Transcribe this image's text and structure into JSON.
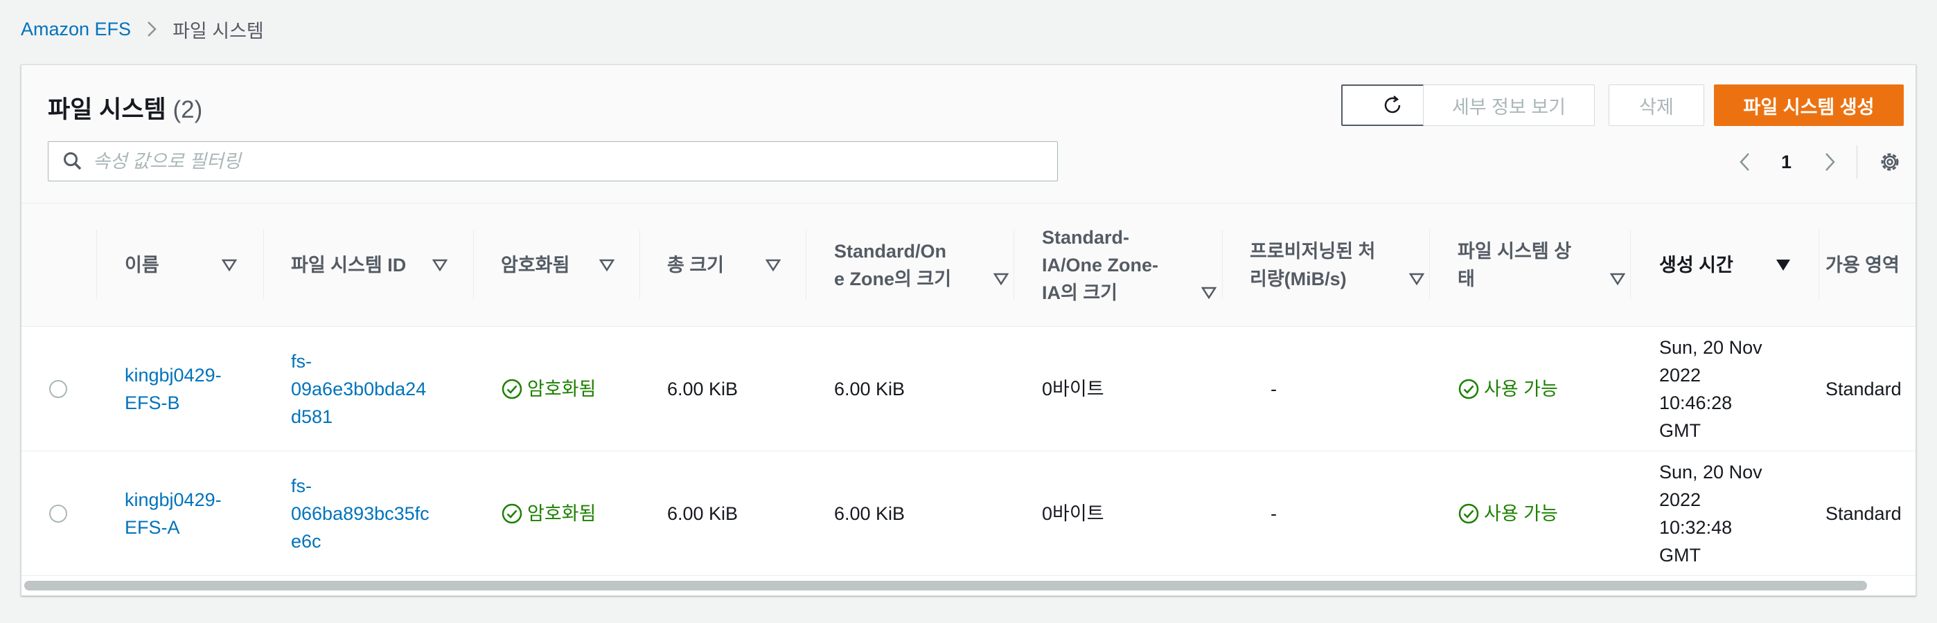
{
  "breadcrumb": {
    "root": "Amazon EFS",
    "current": "파일 시스템"
  },
  "panel": {
    "title": "파일 시스템",
    "count": "(2)",
    "buttons": {
      "details": "세부 정보 보기",
      "delete": "삭제",
      "create": "파일 시스템 생성"
    },
    "search_placeholder": "속성 값으로 필터링",
    "page": "1"
  },
  "columns": {
    "name": "이름",
    "id": "파일 시스템 ID",
    "encrypted": "암호화됨",
    "total_size": "총 크기",
    "standard_size_1": "Standard/On",
    "standard_size_2": "e Zone의 크기",
    "ia_size_1": "Standard-",
    "ia_size_2": "IA/One Zone-",
    "ia_size_3": "IA의 크기",
    "throughput_1": "프로비저닝된 처",
    "throughput_2": "리량(MiB/s)",
    "state_1": "파일 시스템 상",
    "state_2": "태",
    "created": "생성 시간",
    "az": "가용 영역"
  },
  "rows": [
    {
      "name_1": "kingbj0429-",
      "name_2": "EFS-B",
      "id_1": "fs-",
      "id_2": "09a6e3b0bda24",
      "id_3": "d581",
      "encrypted": "암호화됨",
      "total_size": "6.00 KiB",
      "standard_size": "6.00 KiB",
      "ia_size": "0바이트",
      "throughput": "-",
      "state": "사용 가능",
      "created_1": "Sun, 20 Nov",
      "created_2": "2022",
      "created_3": "10:46:28",
      "created_4": "GMT",
      "az": "Standard"
    },
    {
      "name_1": "kingbj0429-",
      "name_2": "EFS-A",
      "id_1": "fs-",
      "id_2": "066ba893bc35fc",
      "id_3": "e6c",
      "encrypted": "암호화됨",
      "total_size": "6.00 KiB",
      "standard_size": "6.00 KiB",
      "ia_size": "0바이트",
      "throughput": "-",
      "state": "사용 가능",
      "created_1": "Sun, 20 Nov",
      "created_2": "2022",
      "created_3": "10:32:48",
      "created_4": "GMT",
      "az": "Standard"
    }
  ],
  "colors": {
    "accent": "#ec7211",
    "link": "#0073bb",
    "success": "#1d8102"
  },
  "icons": [
    "chevron-right-icon",
    "refresh-icon",
    "search-icon",
    "chevron-left-icon",
    "settings-icon",
    "sort-icon",
    "sort-desc-icon",
    "check-circle-icon"
  ]
}
